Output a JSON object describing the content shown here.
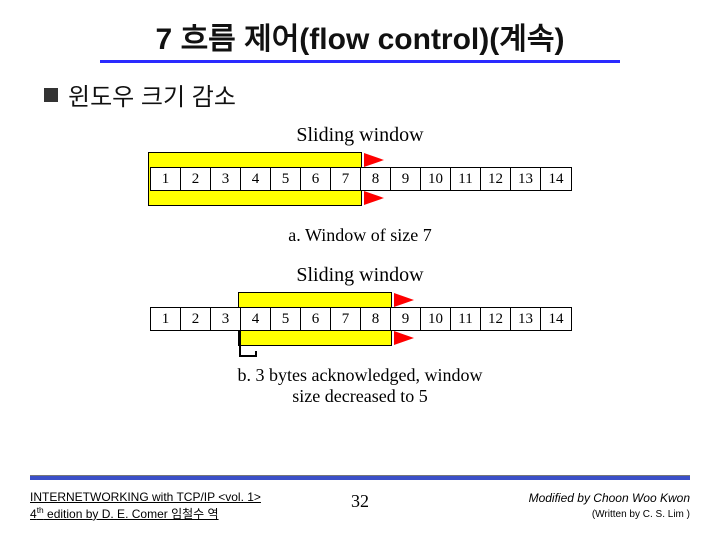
{
  "title": "7 흐름 제어(flow control)(계속)",
  "bullet": "윈도우 크기 감소",
  "figure": {
    "window_label": "Sliding window",
    "cells": [
      "1",
      "2",
      "3",
      "4",
      "5",
      "6",
      "7",
      "8",
      "9",
      "10",
      "11",
      "12",
      "13",
      "14"
    ],
    "a": {
      "highlight_start_idx": 0,
      "highlight_end_idx": 7,
      "caption": "a. Window of size 7"
    },
    "b": {
      "highlight_start_idx": 3,
      "highlight_end_idx": 8,
      "ack_idx": 3,
      "caption": "b. 3 bytes acknowledged, window size decreased to 5"
    }
  },
  "footer": {
    "left_l1": "INTERNETWORKING with TCP/IP <vol. 1>",
    "left_l2_a": "4",
    "left_l2_b": "th",
    "left_l2_c": " edition by D. E. Comer 임철수 역",
    "page": "32",
    "right_l1": "Modified by Choon Woo Kwon",
    "right_l2": "(Written by C. S. Lim )"
  },
  "chart_data": [
    {
      "type": "table",
      "title": "Sliding window — a. Window of size 7",
      "cells": [
        1,
        2,
        3,
        4,
        5,
        6,
        7,
        8,
        9,
        10,
        11,
        12,
        13,
        14
      ],
      "window_range": [
        1,
        7
      ],
      "window_size": 7
    },
    {
      "type": "table",
      "title": "Sliding window — b. 3 bytes acknowledged, window size decreased to 5",
      "cells": [
        1,
        2,
        3,
        4,
        5,
        6,
        7,
        8,
        9,
        10,
        11,
        12,
        13,
        14
      ],
      "acknowledged_through": 3,
      "window_range": [
        4,
        8
      ],
      "window_size": 5
    }
  ]
}
